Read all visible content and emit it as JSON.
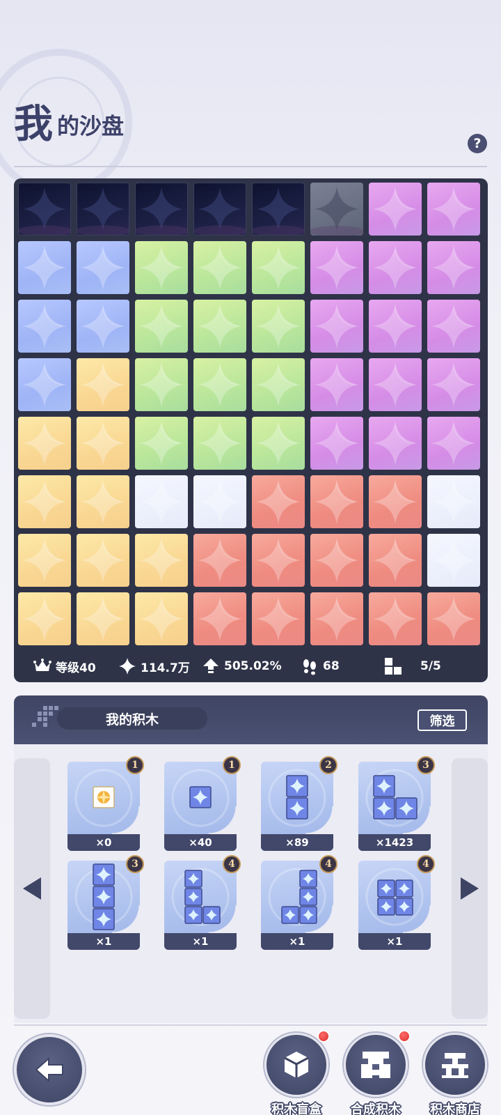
{
  "header": {
    "title_big": "我",
    "title_rest": "的沙盘",
    "help_label": "?"
  },
  "board": {
    "rows": [
      [
        "dark",
        "dark",
        "dark",
        "dark",
        "dark",
        "gray",
        "purple",
        "purple"
      ],
      [
        "blue",
        "blue",
        "green",
        "green",
        "green",
        "purple",
        "purple",
        "purple"
      ],
      [
        "blue",
        "blue",
        "green",
        "green",
        "green",
        "purple",
        "purple",
        "purple"
      ],
      [
        "blue",
        "yellow",
        "green",
        "green",
        "green",
        "purple",
        "purple",
        "purple"
      ],
      [
        "yellow",
        "yellow",
        "green",
        "green",
        "green",
        "purple",
        "purple",
        "purple"
      ],
      [
        "yellow",
        "yellow",
        "white",
        "white",
        "red",
        "red",
        "red",
        "white"
      ],
      [
        "yellow",
        "yellow",
        "yellow",
        "red",
        "red",
        "red",
        "red",
        "white"
      ],
      [
        "yellow",
        "yellow",
        "yellow",
        "red",
        "red",
        "red",
        "red",
        "red"
      ]
    ],
    "stats": {
      "level": "等级40",
      "sparkle": "114.7万",
      "percent": "505.02%",
      "steps": "68",
      "blocks": "5/5"
    },
    "icons": {
      "level": "crown-icon",
      "sparkle": "sparkle-icon",
      "percent": "upgrade-arrow-icon",
      "steps": "footprints-icon",
      "blocks": "blocks-icon"
    }
  },
  "blocks_section": {
    "tab_label": "我的积木",
    "filter_label": "筛选",
    "cards": [
      {
        "badge": "1",
        "count": "×0",
        "shape": "gold"
      },
      {
        "badge": "1",
        "count": "×40",
        "shape": "single"
      },
      {
        "badge": "2",
        "count": "×89",
        "shape": "vertical2"
      },
      {
        "badge": "3",
        "count": "×1423",
        "shape": "corner3"
      },
      {
        "badge": "3",
        "count": "×1",
        "shape": "vertical3"
      },
      {
        "badge": "4",
        "count": "×1",
        "shape": "L4"
      },
      {
        "badge": "4",
        "count": "×1",
        "shape": "J4"
      },
      {
        "badge": "4",
        "count": "×1",
        "shape": "square4"
      }
    ]
  },
  "bottom_nav": {
    "back_icon": "back-arrow-icon",
    "items": [
      {
        "label": "积木盲盒",
        "icon": "blind-box-icon"
      },
      {
        "label": "合成积木",
        "icon": "synthesis-icon"
      },
      {
        "label": "积木商店",
        "icon": "shop-icon"
      }
    ]
  },
  "colors": {
    "accent": "#3c4169",
    "panel": "#2f3348",
    "badge_ring": "#c59a5a"
  }
}
